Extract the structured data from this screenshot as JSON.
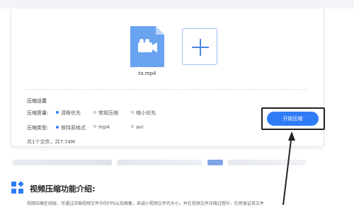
{
  "file": {
    "name": "ta.mp4",
    "icon": "video-file-icon",
    "icon_color": "#6aa3f0"
  },
  "add_button": {
    "icon": "plus-icon"
  },
  "settings": {
    "title": "压缩设置",
    "quality_label": "压缩质量:",
    "quality_options": [
      "清晰优先",
      "常规压缩",
      "缩小优先"
    ],
    "quality_selected": 0,
    "type_label": "压缩类型:",
    "type_options": [
      "保持原格式",
      "mp4",
      "avi"
    ],
    "type_selected": 0
  },
  "start_button": {
    "label": "开始压缩",
    "color": "#2f7cf6"
  },
  "summary": "共1个文件，共7.74M",
  "section": {
    "icon": "apps-grid-icon",
    "title": "视频压缩功能介绍:",
    "description": "视频压缩在线版，可通过压缩视频文件中的FPS以及图像，来减小视频文件的大小，并在视频文件压缩过程中，仍然保证其文件"
  }
}
